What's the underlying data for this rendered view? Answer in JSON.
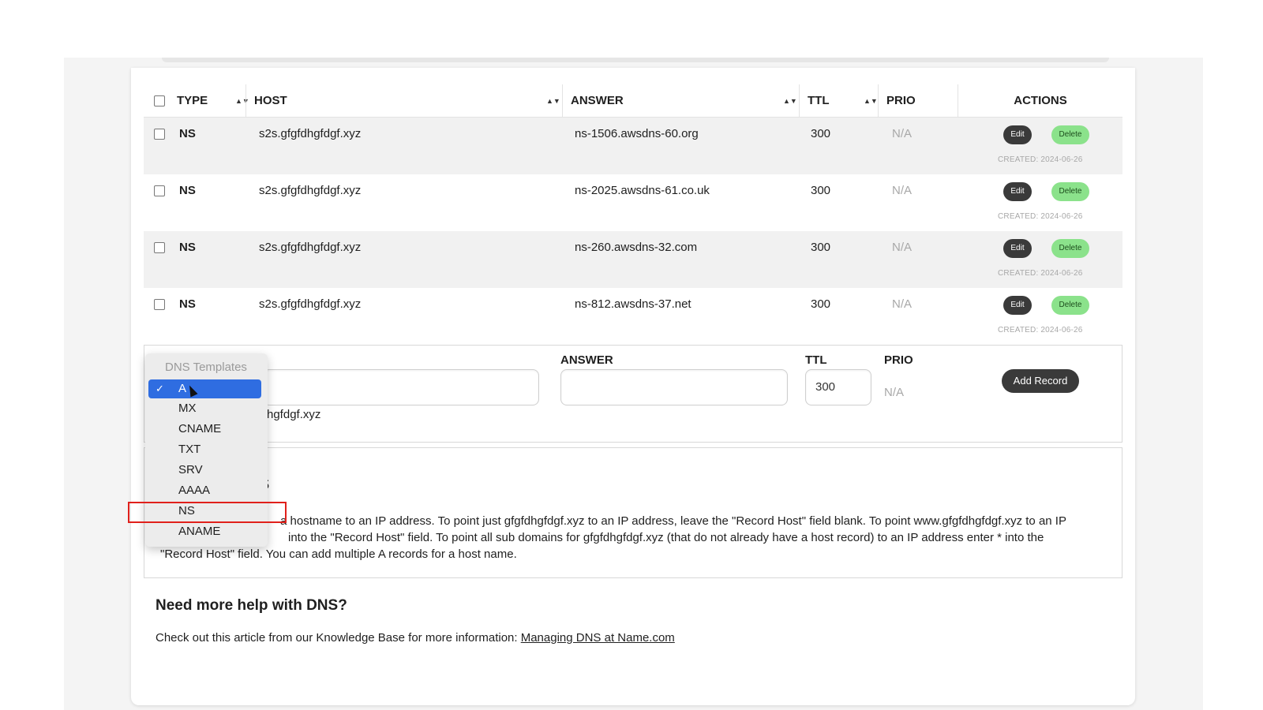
{
  "table": {
    "headers": {
      "type": "TYPE",
      "host": "HOST",
      "answer": "ANSWER",
      "ttl": "TTL",
      "prio": "PRIO",
      "actions": "ACTIONS"
    },
    "rows": [
      {
        "type": "NS",
        "host": "s2s.gfgfdhgfdgf.xyz",
        "answer": "ns-1506.awsdns-60.org",
        "ttl": "300",
        "prio": "N/A",
        "edit": "Edit",
        "delete": "Delete",
        "created": "CREATED: 2024-06-26"
      },
      {
        "type": "NS",
        "host": "s2s.gfgfdhgfdgf.xyz",
        "answer": "ns-2025.awsdns-61.co.uk",
        "ttl": "300",
        "prio": "N/A",
        "edit": "Edit",
        "delete": "Delete",
        "created": "CREATED: 2024-06-26"
      },
      {
        "type": "NS",
        "host": "s2s.gfgfdhgfdgf.xyz",
        "answer": "ns-260.awsdns-32.com",
        "ttl": "300",
        "prio": "N/A",
        "edit": "Edit",
        "delete": "Delete",
        "created": "CREATED: 2024-06-26"
      },
      {
        "type": "NS",
        "host": "s2s.gfgfdhgfdgf.xyz",
        "answer": "ns-812.awsdns-37.net",
        "ttl": "300",
        "prio": "N/A",
        "edit": "Edit",
        "delete": "Delete",
        "created": "CREATED: 2024-06-26"
      }
    ]
  },
  "form": {
    "answer_label": "ANSWER",
    "ttl_label": "TTL",
    "prio_label": "PRIO",
    "ttl_value": "300",
    "prio_value": "N/A",
    "host_suffix": "hgfdgf.xyz",
    "add_button": "Add Record"
  },
  "info": {
    "heading_visible": "s",
    "text": "a hostname to an IP address. To point just gfgfdhgfdgf.xyz to an IP address, leave the \"Record Host\" field blank. To point www.gfgfdhgfdgf.xyz to an IP",
    "text_line2": "into the \"Record Host\" field. To point all sub domains for gfgfdhgfdgf.xyz (that do not already have a host record) to an IP address enter * into the",
    "text_line3": "\"Record Host\" field. You can add multiple A records for a host name."
  },
  "help": {
    "title": "Need more help with DNS?",
    "text": "Check out this article from our Knowledge Base for more information: ",
    "link": "Managing DNS at Name.com"
  },
  "dropdown": {
    "group_label": "DNS Templates",
    "selected": "A",
    "options": [
      "A",
      "MX",
      "CNAME",
      "TXT",
      "SRV",
      "AAAA",
      "NS",
      "ANAME"
    ],
    "highlighted_option": "NS"
  },
  "colors": {
    "selected_option": "#2f6de1",
    "delete_button": "#8be28b",
    "dark_button": "#3a3a3a",
    "highlight_box": "#e0201b"
  }
}
